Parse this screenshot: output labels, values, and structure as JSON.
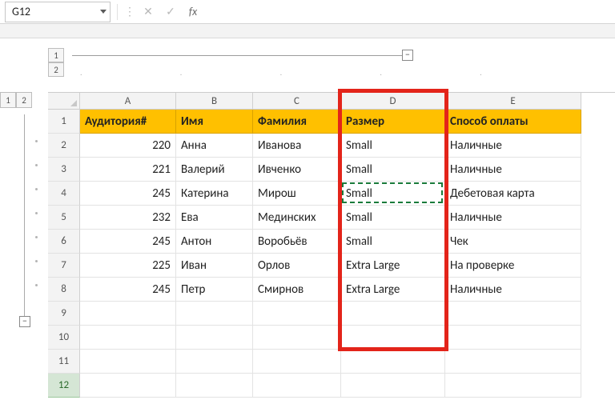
{
  "formula_bar": {
    "name_box_value": "G12",
    "cancel_icon": "✕",
    "enter_icon": "✓",
    "fx_label": "fx",
    "formula_value": ""
  },
  "outline": {
    "top_levels": [
      "1",
      "2"
    ],
    "side_levels": [
      "1",
      "2"
    ],
    "collapse_symbol": "−"
  },
  "columns": [
    {
      "letter": "A",
      "width_class": "cA"
    },
    {
      "letter": "B",
      "width_class": "cB"
    },
    {
      "letter": "C",
      "width_class": "cC"
    },
    {
      "letter": "D",
      "width_class": "cD"
    },
    {
      "letter": "E",
      "width_class": "cE"
    }
  ],
  "headers": {
    "A": "Аудитория#",
    "B": "Имя",
    "C": "Фамилия",
    "D": "Размер",
    "E": "Способ оплаты"
  },
  "rows": [
    {
      "n": 2,
      "A": "220",
      "B": "Анна",
      "C": "Иванова",
      "D": "Small",
      "E": "Наличные"
    },
    {
      "n": 3,
      "A": "221",
      "B": "Валерий",
      "C": "Ивченко",
      "D": "Small",
      "E": "Наличные"
    },
    {
      "n": 4,
      "A": "245",
      "B": "Катерина",
      "C": "Мирош",
      "D": "Small",
      "E": "Дебетовая карта"
    },
    {
      "n": 5,
      "A": "232",
      "B": "Ева",
      "C": "Мединских",
      "D": "Small",
      "E": "Наличные"
    },
    {
      "n": 6,
      "A": "245",
      "B": "Антон",
      "C": "Воробьёв",
      "D": "Small",
      "E": "Чек"
    },
    {
      "n": 7,
      "A": "225",
      "B": "Иван",
      "C": "Орлов",
      "D": "Extra Large",
      "E": "На проверке"
    },
    {
      "n": 8,
      "A": "245",
      "B": "Петр",
      "C": "Смирнов",
      "D": "Extra Large",
      "E": "Наличные"
    }
  ],
  "empty_rows": [
    9,
    10,
    11,
    12
  ],
  "highlight": {
    "column": "D",
    "copied_cell": "D4"
  },
  "active_row": 12
}
